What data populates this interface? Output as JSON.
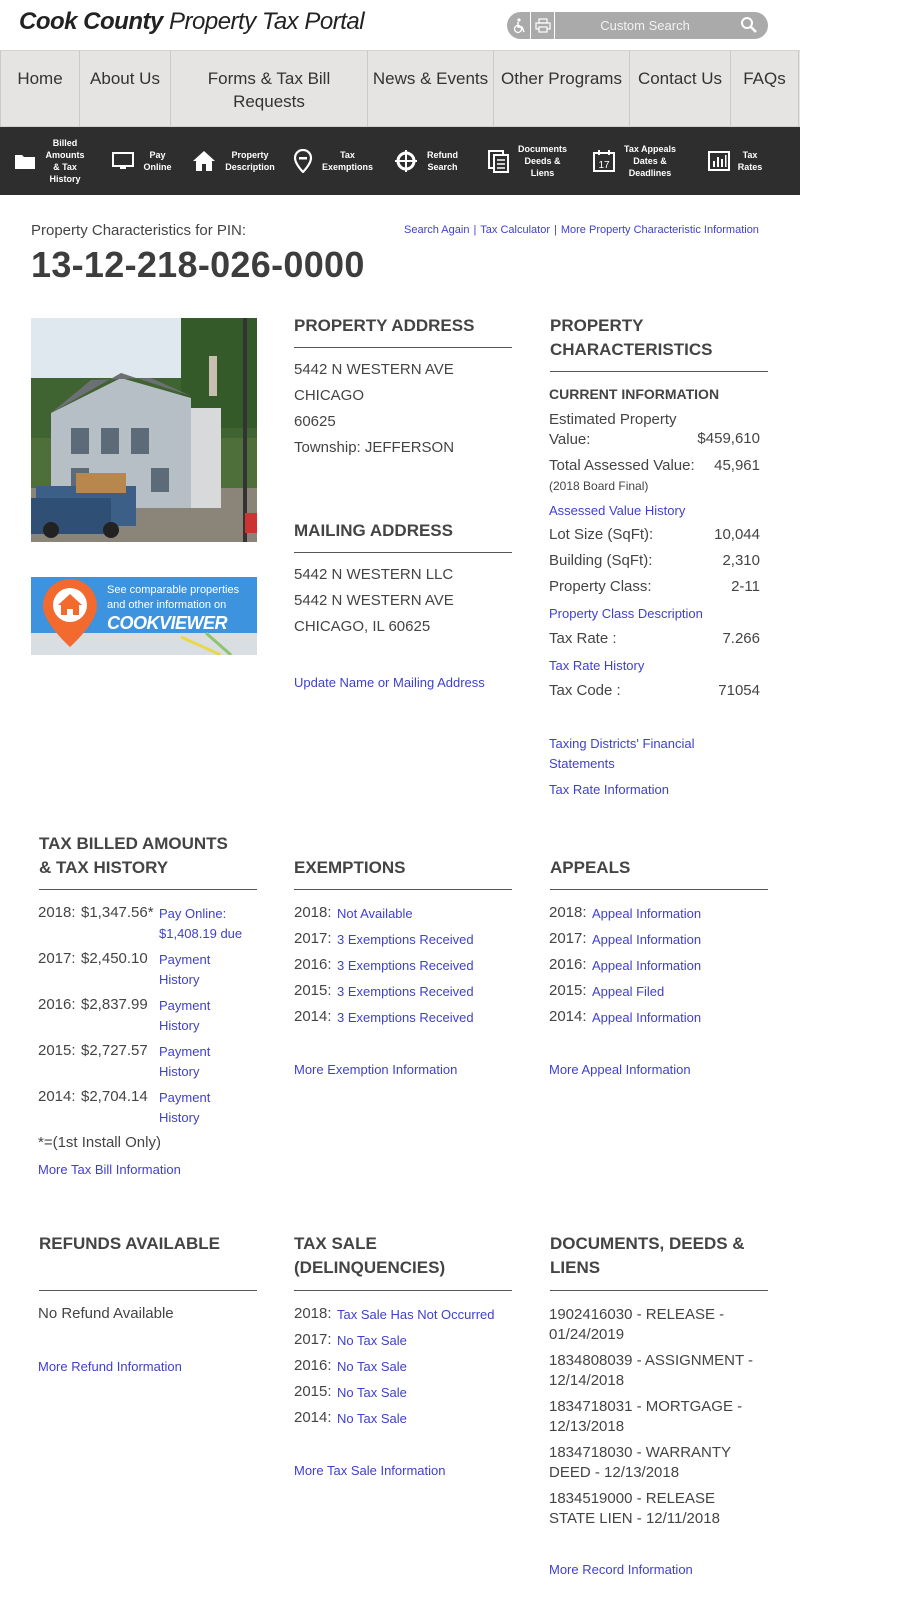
{
  "header": {
    "logo_bold": "Cook County",
    "logo_light": "Property Tax Portal",
    "search_placeholder": "Custom Search",
    "accessibility_icon": "wheelchair-icon",
    "print_icon": "printer-icon"
  },
  "main_nav": [
    "Home",
    "About Us",
    "Forms & Tax Bill Requests",
    "News & Events",
    "Other Programs",
    "Contact Us",
    "FAQs"
  ],
  "icon_nav": [
    {
      "icon": "folder-icon",
      "label": "Billed Amounts & Tax History"
    },
    {
      "icon": "monitor-icon",
      "label": "Pay Online"
    },
    {
      "icon": "home-icon",
      "label": "Property Description"
    },
    {
      "icon": "map-pin-icon",
      "label": "Tax Exemptions"
    },
    {
      "icon": "crosshair-icon",
      "label": "Refund Search"
    },
    {
      "icon": "documents-icon",
      "label": "Documents Deeds & Liens"
    },
    {
      "icon": "calendar-icon",
      "label": "Tax Appeals Dates & Deadlines"
    },
    {
      "icon": "bar-chart-icon",
      "label": "Tax Rates"
    }
  ],
  "property": {
    "pin_label": "Property Characteristics for PIN:",
    "pin": "13-12-218-026-0000",
    "links": [
      "Search Again",
      "Tax Calculator",
      "More Property Characteristic Information"
    ]
  },
  "cookviewer": {
    "text1": "See comparable properties",
    "text2": "and other information on",
    "brand": "COOKVIEWER"
  },
  "property_address": {
    "title": "PROPERTY ADDRESS",
    "lines": [
      "5442 N WESTERN AVE",
      "CHICAGO",
      "60625",
      "Township: JEFFERSON"
    ]
  },
  "mailing_address": {
    "title": "MAILING ADDRESS",
    "lines": [
      "5442 N WESTERN LLC",
      "5442 N WESTERN AVE",
      "CHICAGO, IL 60625"
    ],
    "update_link": "Update Name or Mailing Address"
  },
  "characteristics": {
    "title": "PROPERTY CHARACTERISTICS",
    "subtitle": "CURRENT INFORMATION",
    "est_label": "Estimated Property Value:",
    "est_value": "$459,610",
    "assessed_label": "Total Assessed Value:",
    "assessed_value": "45,961",
    "assessed_note": "(2018 Board Final)",
    "assessed_history": "Assessed Value History",
    "lot_label": "Lot Size (SqFt):",
    "lot_value": "10,044",
    "bldg_label": "Building (SqFt):",
    "bldg_value": "2,310",
    "class_label": "Property Class:",
    "class_value": "2-11",
    "class_link": "Property Class Description",
    "rate_label": "Tax Rate :",
    "rate_value": "7.266",
    "rate_link": "Tax Rate History",
    "code_label": "Tax Code :",
    "code_value": "71054",
    "financial_link": "Taxing Districts' Financial Statements",
    "rate_info_link": "Tax Rate Information"
  },
  "tax_billed": {
    "title": "TAX BILLED AMOUNTS & TAX HISTORY",
    "rows": [
      {
        "year": "2018:",
        "amount": "$1,347.56*",
        "link": "Pay Online: $1,408.19 due"
      },
      {
        "year": "2017:",
        "amount": "$2,450.10",
        "link": "Payment History"
      },
      {
        "year": "2016:",
        "amount": "$2,837.99",
        "link": "Payment History"
      },
      {
        "year": "2015:",
        "amount": "$2,727.57",
        "link": "Payment History"
      },
      {
        "year": "2014:",
        "amount": "$2,704.14",
        "link": "Payment History"
      }
    ],
    "footnote": "*=(1st Install Only)",
    "more": "More Tax Bill Information"
  },
  "exemptions": {
    "title": "EXEMPTIONS",
    "rows": [
      {
        "year": "2018:",
        "link": "Not Available"
      },
      {
        "year": "2017:",
        "link": "3 Exemptions Received"
      },
      {
        "year": "2016:",
        "link": "3 Exemptions Received"
      },
      {
        "year": "2015:",
        "link": "3 Exemptions Received"
      },
      {
        "year": "2014:",
        "link": "3 Exemptions Received"
      }
    ],
    "more": "More Exemption Information"
  },
  "appeals": {
    "title": "APPEALS",
    "rows": [
      {
        "year": "2018:",
        "link": "Appeal Information"
      },
      {
        "year": "2017:",
        "link": "Appeal Information"
      },
      {
        "year": "2016:",
        "link": "Appeal Information"
      },
      {
        "year": "2015:",
        "link": "Appeal Filed"
      },
      {
        "year": "2014:",
        "link": "Appeal Information"
      }
    ],
    "more": "More Appeal Information"
  },
  "refunds": {
    "title": "REFUNDS AVAILABLE",
    "status": "No Refund Available",
    "more": "More Refund Information"
  },
  "tax_sale": {
    "title": "TAX SALE (DELINQUENCIES)",
    "rows": [
      {
        "year": "2018:",
        "link": "Tax Sale Has Not Occurred"
      },
      {
        "year": "2017:",
        "link": "No Tax Sale"
      },
      {
        "year": "2016:",
        "link": "No Tax Sale"
      },
      {
        "year": "2015:",
        "link": "No Tax Sale"
      },
      {
        "year": "2014:",
        "link": "No Tax Sale"
      }
    ],
    "more": "More Tax Sale Information"
  },
  "documents": {
    "title": "DOCUMENTS, DEEDS & LIENS",
    "rows": [
      "1902416030 - RELEASE - 01/24/2019",
      "1834808039 - ASSIGNMENT - 12/14/2018",
      "1834718031 - MORTGAGE - 12/13/2018",
      "1834718030 - WARRANTY DEED - 12/13/2018",
      "1834519000 - RELEASE STATE LIEN - 12/11/2018"
    ],
    "more": "More Record Information"
  }
}
